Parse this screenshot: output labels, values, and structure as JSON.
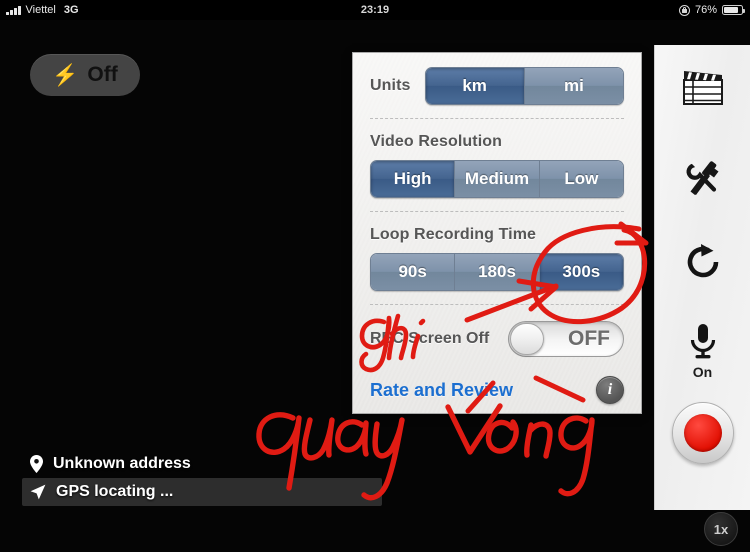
{
  "status_bar": {
    "carrier": "Viettel",
    "network_type": "3G",
    "time": "23:19",
    "battery_percent": "76%",
    "rotation_lock_icon": "rotation-lock-icon",
    "signal_icon": "signal-bars-icon",
    "battery_icon": "battery-icon"
  },
  "flash_button": {
    "label": "Off",
    "icon": "lightning-bolt-icon"
  },
  "settings_panel": {
    "units": {
      "label": "Units",
      "options": [
        "km",
        "mi"
      ],
      "selected": "km"
    },
    "video_resolution": {
      "label": "Video Resolution",
      "options": [
        "High",
        "Medium",
        "Low"
      ],
      "selected": "High"
    },
    "loop_recording_time": {
      "label": "Loop Recording Time",
      "options": [
        "90s",
        "180s",
        "300s"
      ],
      "selected": "300s"
    },
    "rec_screen_off": {
      "label": "REC Screen Off",
      "state": "OFF"
    },
    "rate_and_review": {
      "label": "Rate and Review"
    },
    "info_button": {
      "glyph": "i",
      "icon": "info-icon"
    }
  },
  "right_toolbar": {
    "items": [
      {
        "name": "clapperboard-icon",
        "label": ""
      },
      {
        "name": "tools-icon",
        "label": ""
      },
      {
        "name": "rotate-icon",
        "label": ""
      },
      {
        "name": "microphone-icon",
        "label": "On"
      },
      {
        "name": "record-button-icon",
        "label": ""
      }
    ],
    "mic_label": "On"
  },
  "location": {
    "address": "Unknown address",
    "gps_status": "GPS locating ...",
    "pin_icon": "map-pin-icon",
    "arrow_icon": "navigation-arrow-icon"
  },
  "zoom_badge": {
    "label": "1x"
  },
  "annotations": {
    "stroke_color": "#e01b13",
    "notes": [
      {
        "text": "ghi",
        "meaning_position": "near REC Screen Off label"
      },
      {
        "text": "quay vong",
        "meaning_position": "below panel over viewfinder"
      }
    ],
    "marks": [
      "circle-around-300s",
      "arrow-to-300s",
      "arrow-to-rate-and-review"
    ]
  },
  "colors": {
    "accent_blue": "#1c6fd0",
    "segment_selected": "#44648f",
    "segment_unselected": "#7e92aa",
    "record_red": "#e00d00",
    "annotation_red": "#e01b13",
    "panel_bg": "#f2f1ef"
  }
}
